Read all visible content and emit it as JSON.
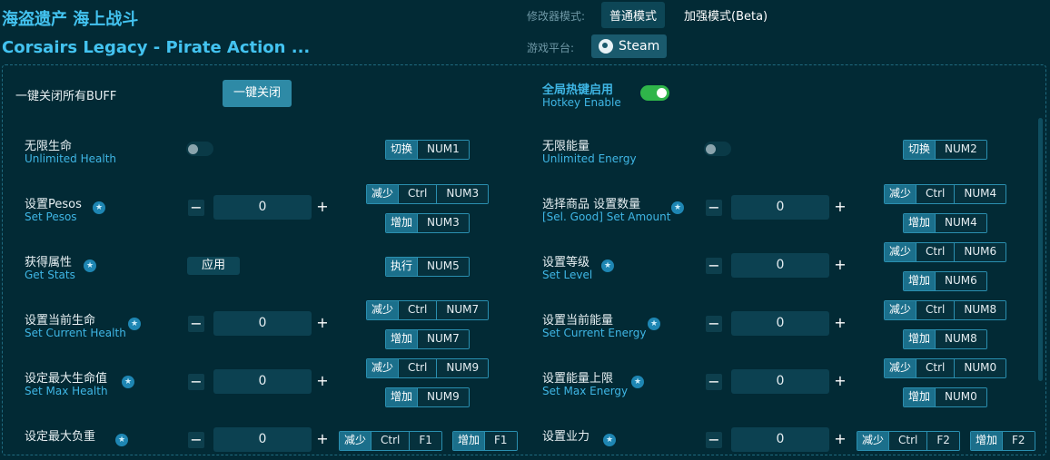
{
  "header": {
    "title_cn": "海盗遗产 海上战斗",
    "title_en": "Corsairs Legacy - Pirate Action ...",
    "mode_label": "修改器模式:",
    "mode_normal": "普通模式",
    "mode_enhanced": "加强模式(Beta)",
    "platform_label": "游戏平台:",
    "platform_name": "Steam"
  },
  "top": {
    "close_all_label": "一键关闭所有BUFF",
    "close_all_button": "一键关闭",
    "hotkey_cn": "全局热键启用",
    "hotkey_en": "Hotkey Enable"
  },
  "keys": {
    "toggle": "切换",
    "dec": "减少",
    "inc": "增加",
    "exec": "执行",
    "apply": "应用",
    "ctrl": "Ctrl",
    "NUM0": "NUM0",
    "NUM1": "NUM1",
    "NUM2": "NUM2",
    "NUM3": "NUM3",
    "NUM4": "NUM4",
    "NUM5": "NUM5",
    "NUM6": "NUM6",
    "NUM7": "NUM7",
    "NUM8": "NUM8",
    "NUM9": "NUM9",
    "F1": "F1",
    "F2": "F2"
  },
  "rows": {
    "r1l": {
      "cn": "无限生命",
      "en": "Unlimited Health"
    },
    "r1r": {
      "cn": "无限能量",
      "en": "Unlimited Energy"
    },
    "r2l": {
      "cn": "设置Pesos",
      "en": "Set Pesos",
      "value": "0"
    },
    "r2r": {
      "cn": "选择商品 设置数量",
      "en": "[Sel. Good] Set Amount",
      "value": "0"
    },
    "r3l": {
      "cn": "获得属性",
      "en": "Get Stats"
    },
    "r3r": {
      "cn": "设置等级",
      "en": "Set Level",
      "value": "0"
    },
    "r4l": {
      "cn": "设置当前生命",
      "en": "Set Current Health",
      "value": "0"
    },
    "r4r": {
      "cn": "设置当前能量",
      "en": "Set Current Energy",
      "value": "0"
    },
    "r5l": {
      "cn": "设定最大生命值",
      "en": "Set Max Health",
      "value": "0"
    },
    "r5r": {
      "cn": "设置能量上限",
      "en": "Set Max Energy",
      "value": "0"
    },
    "r6l": {
      "cn": "设定最大负重",
      "value": "0"
    },
    "r6r": {
      "cn": "设置业力",
      "value": "0"
    }
  },
  "icons": {
    "star": "★",
    "minus": "−",
    "plus": "+"
  }
}
